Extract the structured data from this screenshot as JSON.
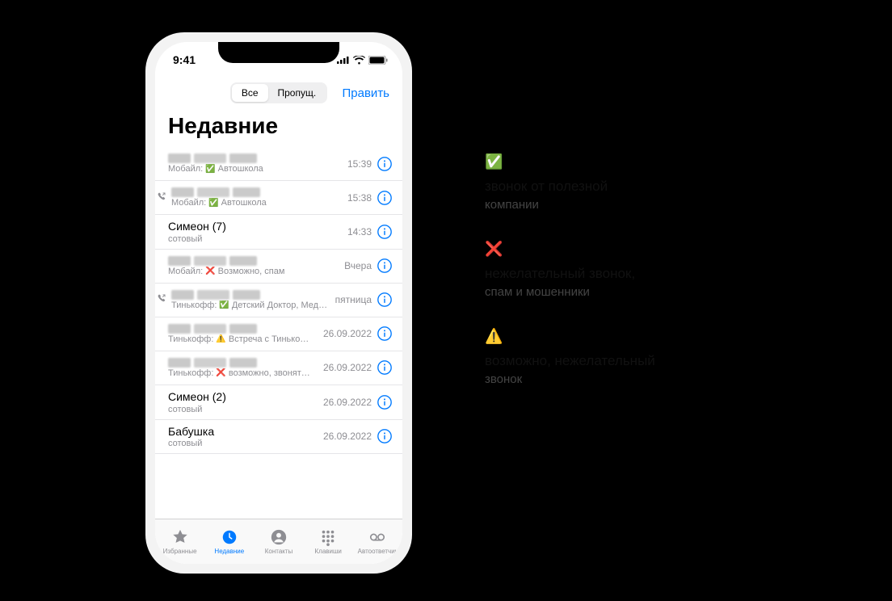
{
  "status": {
    "time": "9:41"
  },
  "nav": {
    "seg_all": "Все",
    "seg_missed": "Пропущ.",
    "edit": "Править"
  },
  "title": "Недавние",
  "rows": [
    {
      "name_redacted": true,
      "sub_prefix": "Мобайл:",
      "badge": "✅",
      "sub_text": "Автошкола",
      "time": "15:39",
      "outgoing": false
    },
    {
      "name_redacted": true,
      "sub_prefix": "Мобайл:",
      "badge": "✅",
      "sub_text": "Автошкола",
      "time": "15:38",
      "outgoing": true
    },
    {
      "name": "Симеон (7)",
      "sub_text": "сотовый",
      "time": "14:33",
      "outgoing": false
    },
    {
      "name_redacted": true,
      "sub_prefix": "Мобайл:",
      "badge": "❌",
      "sub_text": "Возможно, спам",
      "time": "Вчера",
      "outgoing": false
    },
    {
      "name_redacted": true,
      "sub_prefix": "Тинькофф:",
      "badge": "✅",
      "sub_text": "Детский Доктор, Мед…",
      "time": "пятница",
      "outgoing": true
    },
    {
      "name_redacted": true,
      "sub_prefix": "Тинькофф:",
      "badge": "⚠️",
      "sub_text": "Встреча с Тинько…",
      "time": "26.09.2022",
      "outgoing": false
    },
    {
      "name_redacted": true,
      "sub_prefix": "Тинькофф:",
      "badge": "❌",
      "sub_text": "возможно, звонят…",
      "time": "26.09.2022",
      "outgoing": false
    },
    {
      "name": "Симеон (2)",
      "sub_text": "сотовый",
      "time": "26.09.2022",
      "outgoing": false
    },
    {
      "name": "Бабушка",
      "sub_text": "сотовый",
      "time": "26.09.2022",
      "outgoing": false
    }
  ],
  "tabs": {
    "fav": "Избранные",
    "recent": "Недавние",
    "contacts": "Контакты",
    "keypad": "Клавиши",
    "voicemail": "Автоответчик"
  },
  "legend": [
    {
      "icon": "✅",
      "line1": "звонок от полезной",
      "line2": "компании"
    },
    {
      "icon": "❌",
      "line1": "нежелательный звонок,",
      "line2": "спам и мошенники"
    },
    {
      "icon": "⚠️",
      "line1": "возможно, нежелательный",
      "line2": "звонок"
    }
  ]
}
